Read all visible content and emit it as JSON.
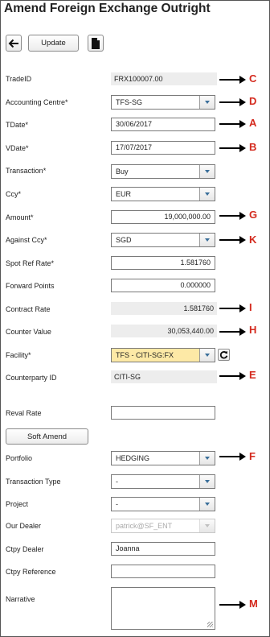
{
  "title": "Amend Foreign Exchange Outright",
  "toolbar": {
    "back_icon": "arrow-left-icon",
    "update_label": "Update",
    "document_icon": "document-icon"
  },
  "fields": {
    "trade_id": {
      "label": "TradeID",
      "value": "FRX100007.00"
    },
    "accounting_centre": {
      "label": "Accounting Centre*",
      "value": "TFS-SG"
    },
    "tdate": {
      "label": "TDate*",
      "value": "30/06/2017"
    },
    "vdate": {
      "label": "VDate*",
      "value": "17/07/2017"
    },
    "transaction": {
      "label": "Transaction*",
      "value": "Buy"
    },
    "ccy": {
      "label": "Ccy*",
      "value": "EUR"
    },
    "amount": {
      "label": "Amount*",
      "value": "19,000,000.00"
    },
    "against_ccy": {
      "label": "Against Ccy*",
      "value": "SGD"
    },
    "spot_ref_rate": {
      "label": "Spot Ref Rate*",
      "value": "1.581760"
    },
    "forward_points": {
      "label": "Forward Points",
      "value": "0.000000"
    },
    "contract_rate": {
      "label": "Contract Rate",
      "value": "1.581760"
    },
    "counter_value": {
      "label": "Counter Value",
      "value": "30,053,440.00"
    },
    "facility": {
      "label": "Facility*",
      "value": "TFS - CITI-SG:FX",
      "refresh_icon": "refresh-icon"
    },
    "counterparty_id": {
      "label": "Counterparty ID",
      "value": "CITI-SG"
    },
    "reval_rate": {
      "label": "Reval Rate",
      "value": ""
    },
    "soft_amend": {
      "label": "Soft Amend"
    },
    "portfolio": {
      "label": "Portfolio",
      "value": "HEDGING"
    },
    "transaction_type": {
      "label": "Transaction Type",
      "value": "-"
    },
    "project": {
      "label": "Project",
      "value": "-"
    },
    "our_dealer": {
      "label": "Our Dealer",
      "value": "patrick@SF_ENT"
    },
    "ctpy_dealer": {
      "label": "Ctpy Dealer",
      "value": "Joanna"
    },
    "ctpy_reference": {
      "label": "Ctpy Reference",
      "value": ""
    },
    "narrative": {
      "label": "Narrative",
      "value": ""
    }
  },
  "annotations": {
    "c": "C",
    "d": "D",
    "a": "A",
    "b": "B",
    "g": "G",
    "k": "K",
    "i": "I",
    "h": "H",
    "e": "E",
    "f": "F",
    "m": "M"
  },
  "colors": {
    "annotation": "#d42a1e",
    "facility_highlight": "#fde9a6",
    "readonly_bg": "#ededed"
  }
}
